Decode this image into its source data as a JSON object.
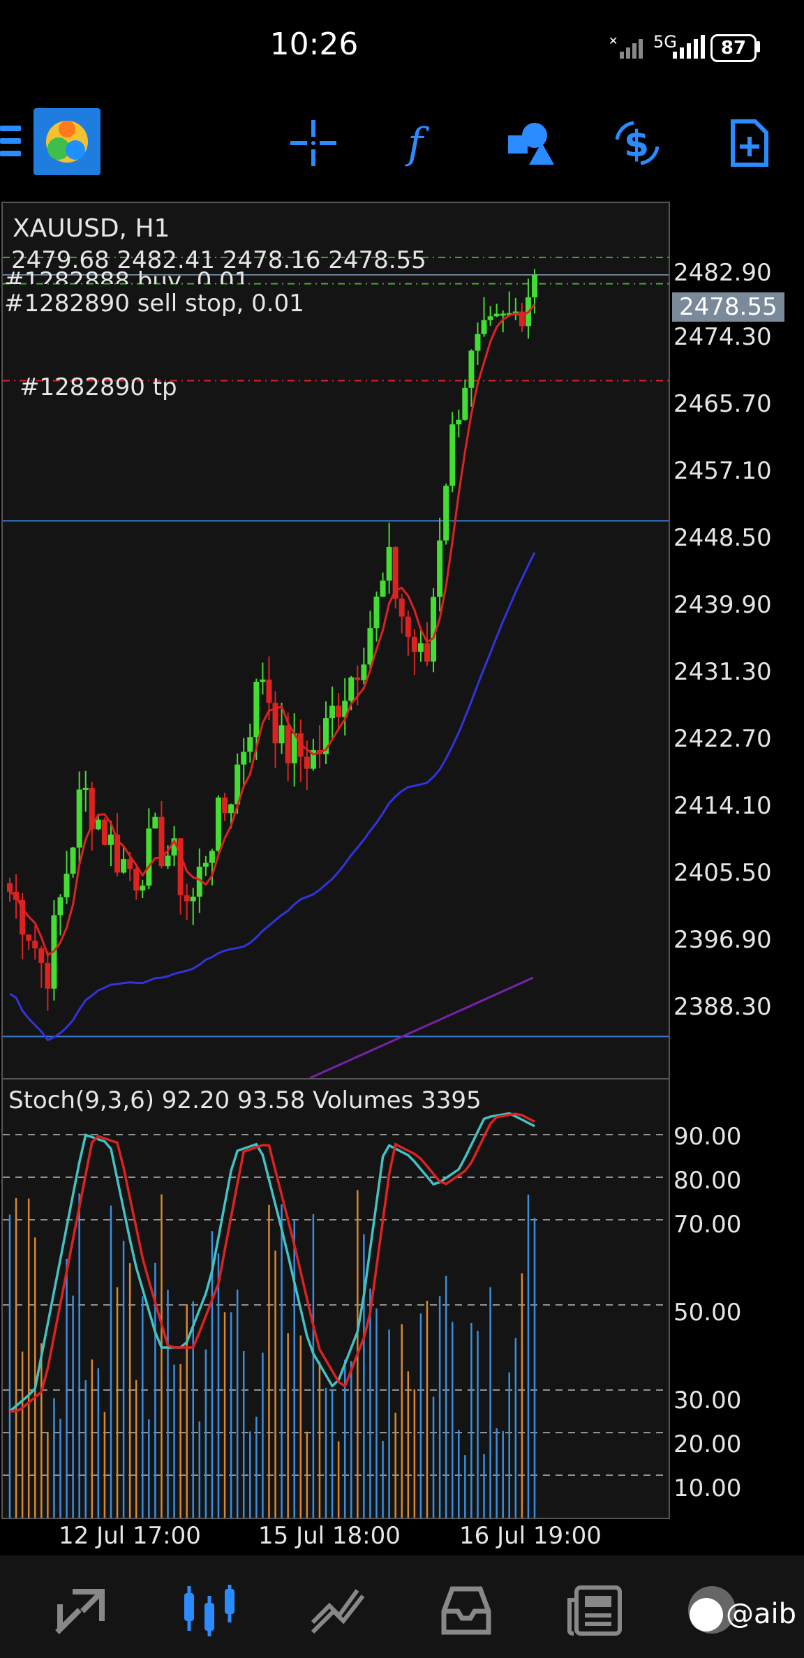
{
  "status_bar": {
    "time": "10:26",
    "network": "5G",
    "battery": "87"
  },
  "toolbar": {
    "icons": [
      "menu-icon",
      "metatrader-logo-icon",
      "crosshair-icon",
      "function-icon",
      "objects-icon",
      "dollar-refresh-icon",
      "new-order-icon"
    ],
    "accent": "#2a8cff"
  },
  "chart": {
    "symbol": "XAUUSD, H1",
    "ohlc": "2479.68 2482.41 2478.16 2478.55",
    "order_buy": "#1282888 buy, 0.01",
    "order_sell_stop": "#1282890 sell stop, 0.01",
    "order_tp": "#1282890 tp",
    "current_price": "2478.55",
    "price_labels": [
      "2482.90",
      "2474.30",
      "2465.70",
      "2457.10",
      "2448.50",
      "2439.90",
      "2431.30",
      "2422.70",
      "2414.10",
      "2405.50",
      "2396.90",
      "2388.30"
    ],
    "time_labels": [
      "12 Jul 17:00",
      "15 Jul 18:00",
      "16 Jul 19:00"
    ],
    "colors": {
      "bull": "#44dd33",
      "bear": "#dd2222",
      "ma_fast": "#dd2222",
      "ma_mid": "#3333dd",
      "ma_slow": "#7722aa",
      "hline": "#3a7cd0"
    }
  },
  "indicator": {
    "label": "Stoch(9,3,6) 92.20 93.58 Volumes 3395",
    "levels": [
      "90.00",
      "80.00",
      "70.00",
      "50.00",
      "30.00",
      "20.00",
      "10.00"
    ],
    "colors": {
      "main": "#44c2c2",
      "signal": "#dd2222",
      "vol_up": "#3a8ee0",
      "vol_down": "#d8882e"
    }
  },
  "chart_data": {
    "type": "candlestick",
    "title": "XAUUSD, H1",
    "ylim": [
      2384.0,
      2487.0
    ],
    "x": [
      "12 Jul 17:00",
      "15 Jul 18:00",
      "16 Jul 19:00"
    ],
    "candles_approx_close": [
      2406,
      2402,
      2396,
      2407,
      2418,
      2414,
      2410,
      2408,
      2412,
      2410,
      2404,
      2412,
      2416,
      2424,
      2432,
      2423,
      2422,
      2422,
      2428,
      2432,
      2438,
      2444,
      2436,
      2432,
      2454,
      2466,
      2470,
      2472,
      2474,
      2478.55
    ],
    "horizontal_lines": [
      2449.6,
      2388.9
    ],
    "order_levels": {
      "buy": 2480.6,
      "sell_stop": 2477.5,
      "tp": 2466.1
    },
    "stochastic": {
      "main": 92.2,
      "signal": 93.58,
      "levels": [
        90,
        80,
        70,
        50,
        30,
        20,
        10
      ]
    },
    "volumes_last": 3395
  },
  "bottom_nav": {
    "items": [
      "quotes-icon",
      "chart-icon",
      "trade-icon",
      "history-icon",
      "news-icon",
      "messages-icon"
    ],
    "watermark": "@aib"
  }
}
